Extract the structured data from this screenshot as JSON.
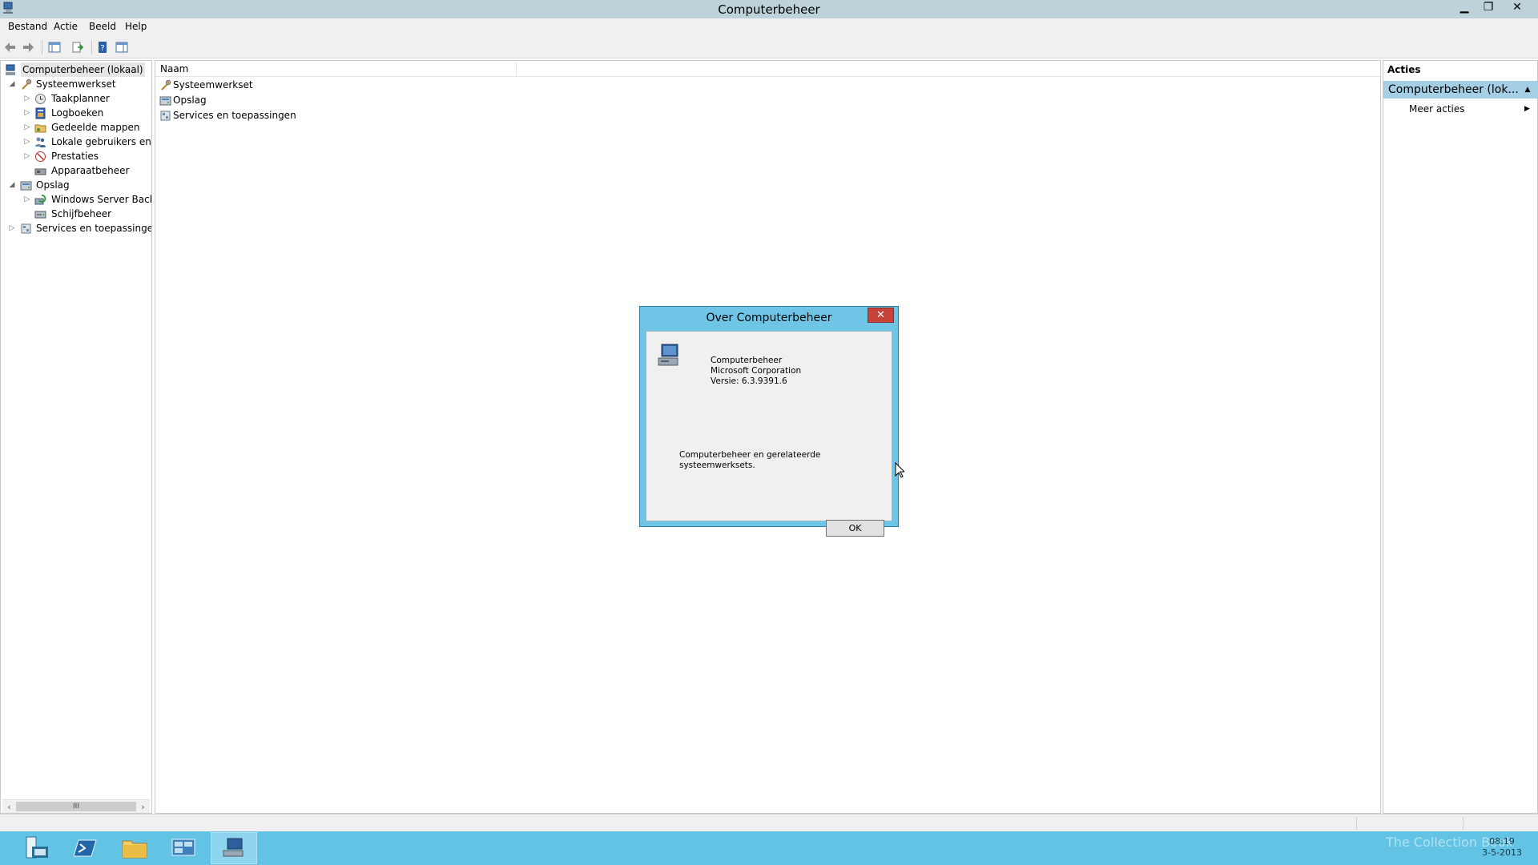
{
  "window": {
    "title": "Computerbeheer",
    "controls": {
      "minimize": "▁",
      "restore": "❐",
      "close": "✕"
    }
  },
  "menu": [
    "Bestand",
    "Actie",
    "Beeld",
    "Help"
  ],
  "toolbar": {
    "icons": [
      "back-icon",
      "forward-icon",
      "show-hide-tree-icon",
      "export-list-icon",
      "help-icon",
      "show-hide-action-pane-icon"
    ]
  },
  "tree": {
    "root": "Computerbeheer (lokaal)",
    "items": [
      {
        "label": "Systeemwerkset",
        "level": 1,
        "expanded": true
      },
      {
        "label": "Taakplanner",
        "level": 2,
        "expanded": false
      },
      {
        "label": "Logboeken",
        "level": 2,
        "expanded": false
      },
      {
        "label": "Gedeelde mappen",
        "level": 2,
        "expanded": false
      },
      {
        "label": "Lokale gebruikers en gr",
        "level": 2,
        "expanded": false
      },
      {
        "label": "Prestaties",
        "level": 2,
        "expanded": false
      },
      {
        "label": "Apparaatbeheer",
        "level": 2,
        "expanded": null
      },
      {
        "label": "Opslag",
        "level": 1,
        "expanded": true
      },
      {
        "label": "Windows Server Back-u",
        "level": 2,
        "expanded": false
      },
      {
        "label": "Schijfbeheer",
        "level": 2,
        "expanded": null
      },
      {
        "label": "Services en toepassingen",
        "level": 1,
        "expanded": false
      }
    ],
    "scrollbar_thumb": "III"
  },
  "list": {
    "column": "Naam",
    "rows": [
      "Systeemwerkset",
      "Opslag",
      "Services en toepassingen"
    ]
  },
  "actions": {
    "header": "Acties",
    "section": "Computerbeheer (lok...",
    "items": [
      "Meer acties"
    ]
  },
  "dialog": {
    "title": "Over Computerbeheer",
    "close": "✕",
    "product": "Computerbeheer",
    "company": "Microsoft Corporation",
    "version": "Versie: 6.3.9391.6",
    "description": "Computerbeheer en gerelateerde systeemwerksets.",
    "ok": "OK"
  },
  "taskbar": {
    "time": "08:19",
    "date": "3-5-2013",
    "watermark": "The Collection Book"
  },
  "colors": {
    "titlebar": "#bdd2d9",
    "dialog_frame": "#6fc5e6",
    "dialog_close": "#c7433a",
    "taskbar": "#63c3e4",
    "actions_section": "#a4cfe5"
  }
}
